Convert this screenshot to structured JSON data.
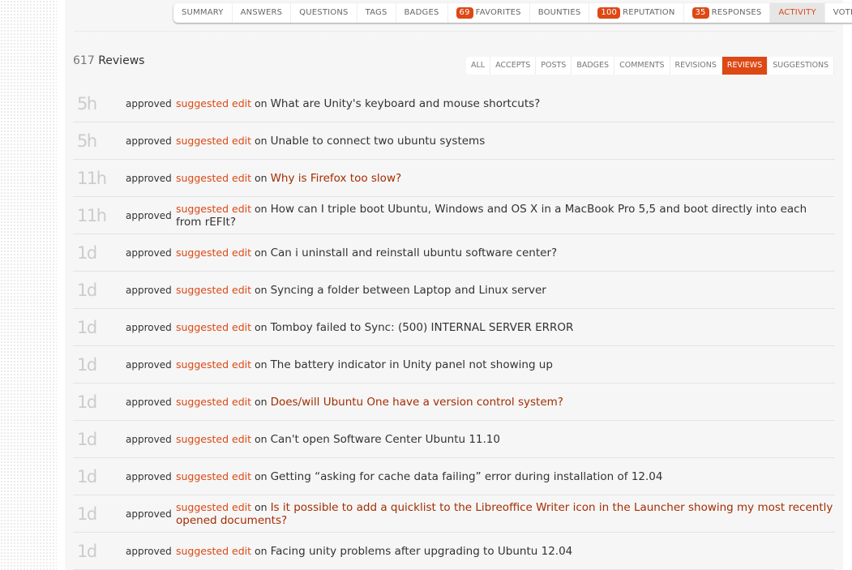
{
  "tabs": [
    {
      "label": "SUMMARY"
    },
    {
      "label": "ANSWERS"
    },
    {
      "label": "QUESTIONS"
    },
    {
      "label": "TAGS"
    },
    {
      "label": "BADGES"
    },
    {
      "label": "FAVORITES",
      "badge": "69"
    },
    {
      "label": "BOUNTIES"
    },
    {
      "label": "REPUTATION",
      "badge": "100"
    },
    {
      "label": "RESPONSES",
      "badge": "35"
    },
    {
      "label": "ACTIVITY",
      "active": true
    },
    {
      "label": "VOTES"
    }
  ],
  "reviews": {
    "count": "617",
    "label": "Reviews"
  },
  "subtabs": [
    {
      "label": "ALL"
    },
    {
      "label": "ACCEPTS"
    },
    {
      "label": "POSTS"
    },
    {
      "label": "BADGES"
    },
    {
      "label": "COMMENTS"
    },
    {
      "label": "REVISIONS"
    },
    {
      "label": "REVIEWS",
      "active": true
    },
    {
      "label": "SUGGESTIONS"
    }
  ],
  "accent": "#dd4814",
  "rows": [
    {
      "time": "5h",
      "action": "approved",
      "type": "suggested edit",
      "on": "on",
      "title": "What are Unity's keyboard and mouse shortcuts?",
      "visited": false
    },
    {
      "time": "5h",
      "action": "approved",
      "type": "suggested edit",
      "on": "on",
      "title": "Unable to connect two ubuntu systems",
      "visited": false
    },
    {
      "time": "11h",
      "action": "approved",
      "type": "suggested edit",
      "on": "on",
      "title": "Why is Firefox too slow?",
      "visited": true
    },
    {
      "time": "11h",
      "action": "approved",
      "type": "suggested edit",
      "on": "on",
      "title": "How can I triple boot Ubuntu, Windows and OS X in a MacBook Pro 5,5 and boot directly into each from rEFIt?",
      "visited": false
    },
    {
      "time": "1d",
      "action": "approved",
      "type": "suggested edit",
      "on": "on",
      "title": "Can i uninstall and reinstall ubuntu software center?",
      "visited": false
    },
    {
      "time": "1d",
      "action": "approved",
      "type": "suggested edit",
      "on": "on",
      "title": "Syncing a folder between Laptop and Linux server",
      "visited": false
    },
    {
      "time": "1d",
      "action": "approved",
      "type": "suggested edit",
      "on": "on",
      "title": "Tomboy failed to Sync: (500) INTERNAL SERVER ERROR",
      "visited": false
    },
    {
      "time": "1d",
      "action": "approved",
      "type": "suggested edit",
      "on": "on",
      "title": "The battery indicator in Unity panel not showing up",
      "visited": false
    },
    {
      "time": "1d",
      "action": "approved",
      "type": "suggested edit",
      "on": "on",
      "title": "Does/will Ubuntu One have a version control system?",
      "visited": true
    },
    {
      "time": "1d",
      "action": "approved",
      "type": "suggested edit",
      "on": "on",
      "title": "Can't open Software Center Ubuntu 11.10",
      "visited": false
    },
    {
      "time": "1d",
      "action": "approved",
      "type": "suggested edit",
      "on": "on",
      "title": "Getting “asking for cache data failing” error during installation of 12.04",
      "visited": false
    },
    {
      "time": "1d",
      "action": "approved",
      "type": "suggested edit",
      "on": "on",
      "title": "Is it possible to add a quicklist to the Libreoffice Writer icon in the Launcher showing my most recently opened documents?",
      "visited": true
    },
    {
      "time": "1d",
      "action": "approved",
      "type": "suggested edit",
      "on": "on",
      "title": "Facing unity problems after upgrading to Ubuntu 12.04",
      "visited": false
    }
  ]
}
